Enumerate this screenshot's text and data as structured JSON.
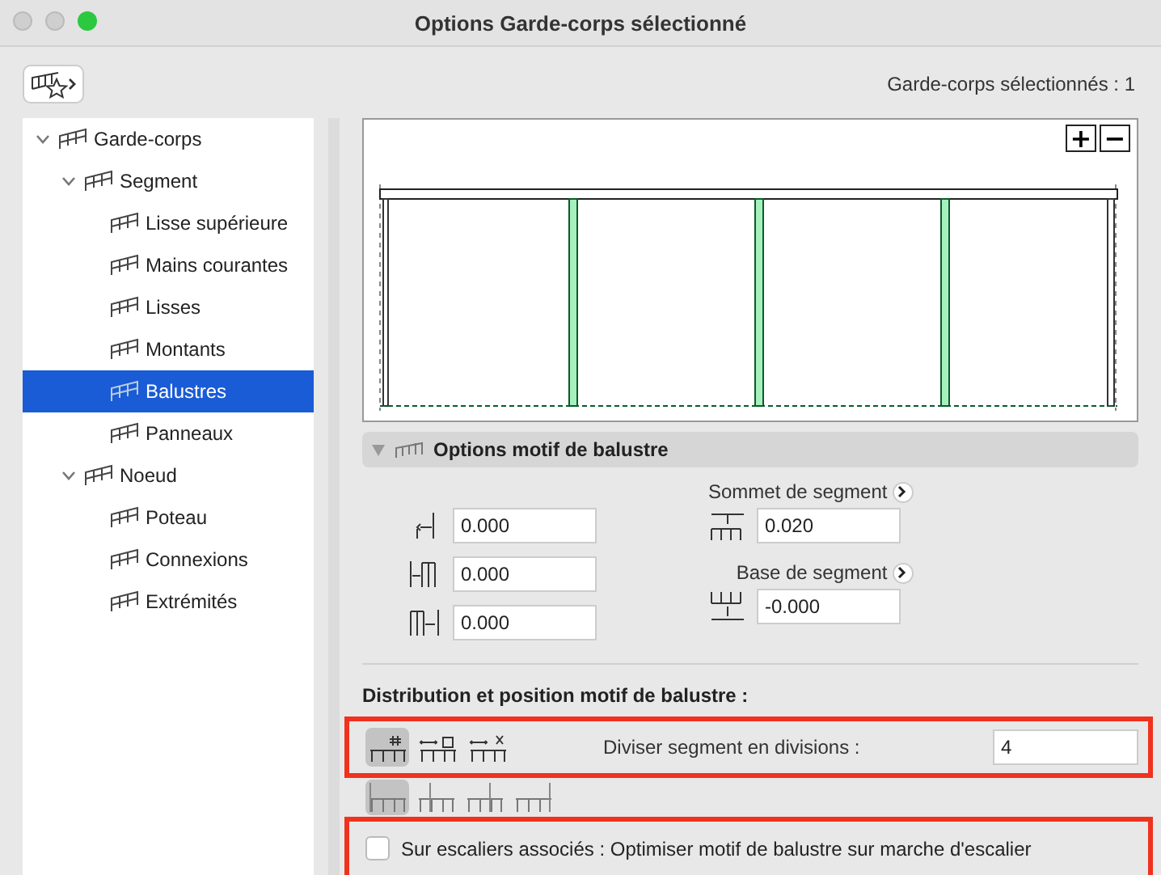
{
  "window": {
    "title": "Options Garde-corps sélectionné"
  },
  "selection_count": "Garde-corps sélectionnés : 1",
  "tree": [
    {
      "label": "Garde-corps",
      "expanded": true,
      "selected": false,
      "children": [
        {
          "label": "Segment",
          "expanded": true,
          "selected": false,
          "children": [
            {
              "label": "Lisse supérieure",
              "selected": false
            },
            {
              "label": "Mains courantes",
              "selected": false
            },
            {
              "label": "Lisses",
              "selected": false
            },
            {
              "label": "Montants",
              "selected": false
            },
            {
              "label": "Balustres",
              "selected": true
            },
            {
              "label": "Panneaux",
              "selected": false
            }
          ]
        },
        {
          "label": "Noeud",
          "expanded": true,
          "selected": false,
          "children": [
            {
              "label": "Poteau",
              "selected": false
            },
            {
              "label": "Connexions",
              "selected": false
            },
            {
              "label": "Extrémités",
              "selected": false
            }
          ]
        }
      ]
    }
  ],
  "preview": {
    "zoom_in": "+",
    "zoom_out": "−"
  },
  "section": {
    "title": "Options motif de balustre",
    "expanded": true
  },
  "offsets": [
    "0.000",
    "0.000",
    "0.000"
  ],
  "top": {
    "label": "Sommet de segment",
    "value": "0.020"
  },
  "base": {
    "label": "Base de segment",
    "value": "-0.000"
  },
  "distribution": {
    "title": "Distribution et position motif de balustre :",
    "modes": [
      {
        "selected": true
      },
      {
        "selected": false
      },
      {
        "selected": false
      }
    ],
    "label": "Diviser segment en divisions :",
    "value": "4",
    "positions": [
      {
        "selected": true
      },
      {
        "selected": false
      },
      {
        "selected": false
      },
      {
        "selected": false
      }
    ]
  },
  "stairs": {
    "label": "Sur escaliers associés : Optimiser motif de balustre sur marche d'escalier",
    "checked": false
  }
}
